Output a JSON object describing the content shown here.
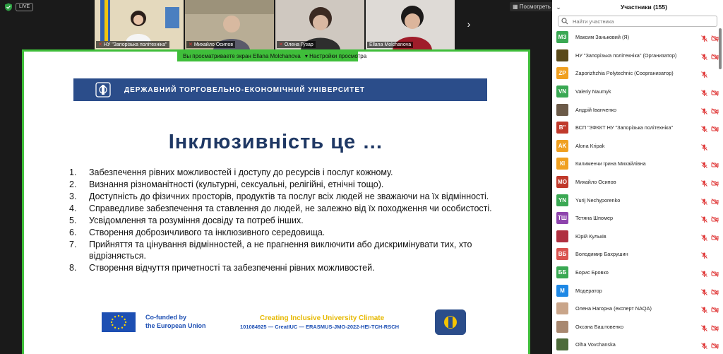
{
  "top": {
    "live_label": "LIVE",
    "view_label": "Посмотреть"
  },
  "video_tiles": [
    {
      "name": "НУ \"Запорізька політехніка\"",
      "bg": "#d8c7a0"
    },
    {
      "name": "Михайло Осипов",
      "bg": "#b6a98c"
    },
    {
      "name": "Олена Гузар",
      "bg": "#c7bfb5"
    },
    {
      "name": "Ellana Molchanova",
      "bg": "#d5d2d0"
    }
  ],
  "share_banner": {
    "text": "Вы просматриваете экран Ellana Molchanova",
    "settings": "Настройки просмотра"
  },
  "slide": {
    "banner_text": "ДЕРЖАВНИЙ ТОРГОВЕЛЬНО-ЕКОНОМІЧНИЙ УНІВЕРСИТЕТ",
    "title": "Інклюзивність це …",
    "items": [
      {
        "num": "1.",
        "text": "Забезпечення рівних можливостей і доступу до ресурсів і послуг кожному."
      },
      {
        "num": "2.",
        "text": "Визнання різноманітності (культурні, сексуальні, релігійні, етнічні тощо)."
      },
      {
        "num": "3.",
        "text": "Доступність до фізичних просторів, продуктів та послуг всіх людей не зважаючи на їх відмінності."
      },
      {
        "num": "4.",
        "text": "Справедливе забезпечення та ставлення до людей, не залежно від їх походження чи особистості."
      },
      {
        "num": "5.",
        "text": "Усвідомлення та розуміння досвіду та потреб інших."
      },
      {
        "num": "6.",
        "text": "Створення доброзичливого та інклюзивного середовища."
      },
      {
        "num": "7.",
        "text": "Прийняття та цінування відмінностей, а не прагнення виключити або дискримінувати тих, хто відрізняється."
      },
      {
        "num": "8.",
        "text": "Створення відчуття причетності та забезпеченні рівних можливостей."
      }
    ],
    "cofunded_line1": "Co-funded by",
    "cofunded_line2": "the European Union",
    "project_title": "Creating Inclusive University Climate",
    "project_code": "101084925 — CreatIUC — ERASMUS-JMO-2022-HEI-TCH-RSCH"
  },
  "participants": {
    "title": "Участники (155)",
    "search_placeholder": "Найти участника",
    "list": [
      {
        "initials": "МЗ",
        "color": "#3aa853",
        "name": "Максим Заньковий (Я)",
        "mic_muted": true,
        "video_off": true
      },
      {
        "initials": "",
        "color": "#5a4a1a",
        "name": "НУ \"Запорізька політехніка\" (Организатор)",
        "mic_muted": true,
        "video_off": true
      },
      {
        "initials": "ZP",
        "color": "#f0a020",
        "name": "Zaporizhzhia Polytechnic (Соорганизатор)",
        "mic_muted": true,
        "video_off": false
      },
      {
        "initials": "VN",
        "color": "#3aa853",
        "name": "Valeriy Naumyk",
        "mic_muted": true,
        "video_off": true
      },
      {
        "initials": "",
        "color": "#6b5a48",
        "name": "Андрій Іванченко",
        "mic_muted": true,
        "video_off": true
      },
      {
        "initials": "В\"",
        "color": "#c0392b",
        "name": "ВСП \"ЗФККТ НУ \"Запорізька політехніка\"",
        "mic_muted": true,
        "video_off": true
      },
      {
        "initials": "AK",
        "color": "#f0a020",
        "name": "Alona Kripak",
        "mic_muted": true,
        "video_off": false
      },
      {
        "initials": "КІ",
        "color": "#f0a020",
        "name": "Килименчи Ірина Михайлівна",
        "mic_muted": true,
        "video_off": true
      },
      {
        "initials": "МО",
        "color": "#c0392b",
        "name": "Михайло Осипов",
        "mic_muted": true,
        "video_off": true
      },
      {
        "initials": "YN",
        "color": "#3aa853",
        "name": "Yurij Nechyporenko",
        "mic_muted": true,
        "video_off": true
      },
      {
        "initials": "ТШ",
        "color": "#8e44ad",
        "name": "Тетяна Шпомер",
        "mic_muted": true,
        "video_off": true
      },
      {
        "initials": "",
        "color": "#b03040",
        "name": "Юрій Кульків",
        "mic_muted": true,
        "video_off": true
      },
      {
        "initials": "ВБ",
        "color": "#d9534f",
        "name": "Володимир Бахрушин",
        "mic_muted": true,
        "video_off": false
      },
      {
        "initials": "ББ",
        "color": "#3aa853",
        "name": "Борис Бровко",
        "mic_muted": true,
        "video_off": true
      },
      {
        "initials": "М",
        "color": "#1e88e5",
        "name": "Модератор",
        "mic_muted": true,
        "video_off": true
      },
      {
        "initials": "",
        "color": "#c9a58a",
        "name": "Олена Нагорна (експерт NAQA)",
        "mic_muted": true,
        "video_off": true
      },
      {
        "initials": "",
        "color": "#a88870",
        "name": "Оксана Баштовенко",
        "mic_muted": true,
        "video_off": true
      },
      {
        "initials": "",
        "color": "#4d6b3a",
        "name": "Olha Vovchanska",
        "mic_muted": true,
        "video_off": true
      }
    ]
  },
  "colors": {
    "share_border": "#3fbe3a",
    "slide_title": "#1f3864",
    "banner": "#2b4d8a",
    "muted_icon": "#e03b3b"
  }
}
